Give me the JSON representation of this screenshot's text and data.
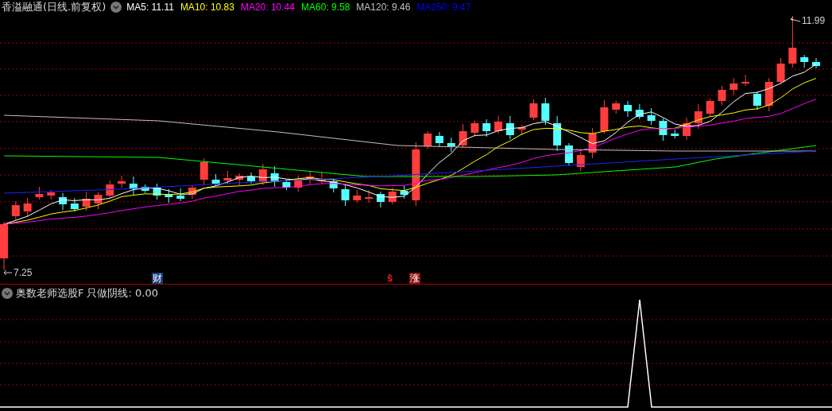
{
  "title": "香溢融通(日线.前复权)",
  "ma_legend": [
    {
      "label": "MA5: 11.11",
      "color": "#ffffff"
    },
    {
      "label": "MA10: 10.83",
      "color": "#ffff00"
    },
    {
      "label": "MA20: 10.44",
      "color": "#ff00ff"
    },
    {
      "label": "MA60: 9.58",
      "color": "#00ff00"
    },
    {
      "label": "MA120: 9.46",
      "color": "#c0c0c0"
    },
    {
      "label": "MA250: 9.47",
      "color": "#0000ff"
    }
  ],
  "price_labels": {
    "high": "11.99",
    "low": "7.25"
  },
  "event_markers": [
    {
      "kind": "finance",
      "text": "财"
    },
    {
      "kind": "signal",
      "text": "ŝ"
    },
    {
      "kind": "limit_up",
      "text": "涨"
    }
  ],
  "indicator": {
    "title": "奥数老师选股F",
    "label": "只做阴线: 0.00"
  }
}
